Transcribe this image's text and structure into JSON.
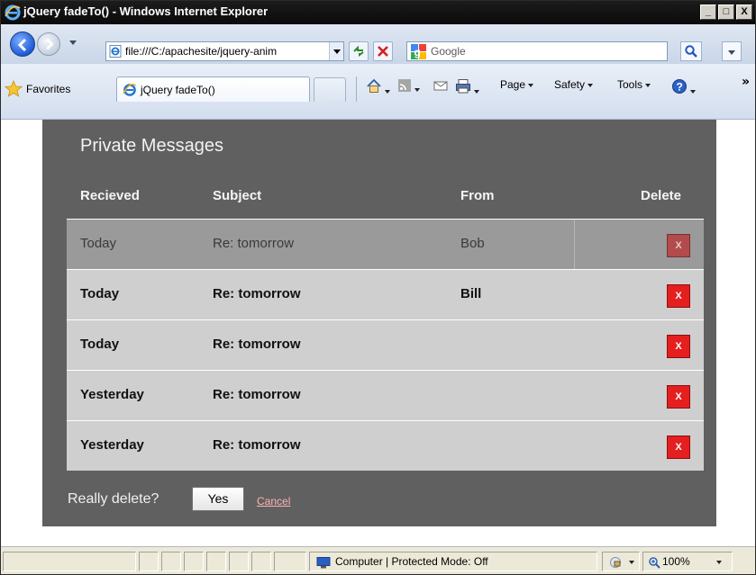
{
  "window": {
    "title": "jQuery fadeTo() - Windows Internet Explorer",
    "minimize": "_",
    "maximize": "□",
    "close": "X"
  },
  "address": {
    "url": "file:///C:/apachesite/jquery-anim",
    "search_placeholder": "Google"
  },
  "toolbar": {
    "favorites_label": "Favorites",
    "tab_title": "jQuery fadeTo()",
    "page_label": "Page",
    "safety_label": "Safety",
    "tools_label": "Tools"
  },
  "panel": {
    "title": "Private Messages",
    "columns": {
      "received": "Recieved",
      "subject": "Subject",
      "from": "From",
      "delete": "Delete"
    },
    "rows": [
      {
        "received": "Today",
        "subject": "Re: tomorrow",
        "from": "Bob",
        "delete": "X",
        "faded": true
      },
      {
        "received": "Today",
        "subject": "Re: tomorrow",
        "from": "Bill",
        "delete": "X",
        "faded": false
      },
      {
        "received": "Today",
        "subject": "Re: tomorrow",
        "from": "",
        "delete": "X",
        "faded": false
      },
      {
        "received": "Yesterday",
        "subject": "Re: tomorrow",
        "from": "",
        "delete": "X",
        "faded": false
      },
      {
        "received": "Yesterday",
        "subject": "Re: tomorrow",
        "from": "",
        "delete": "X",
        "faded": false
      }
    ],
    "confirm_question": "Really delete?",
    "yes_label": "Yes",
    "cancel_label": "Cancel"
  },
  "status": {
    "zone": "Computer | Protected Mode: Off",
    "zoom": "100%"
  },
  "colors": {
    "panel_bg": "#606060",
    "row_bg": "#cfcfcf",
    "faded_row_bg": "#9a9a9a",
    "delete_red": "#e51f1f",
    "cancel_link": "#ffb3b3"
  }
}
